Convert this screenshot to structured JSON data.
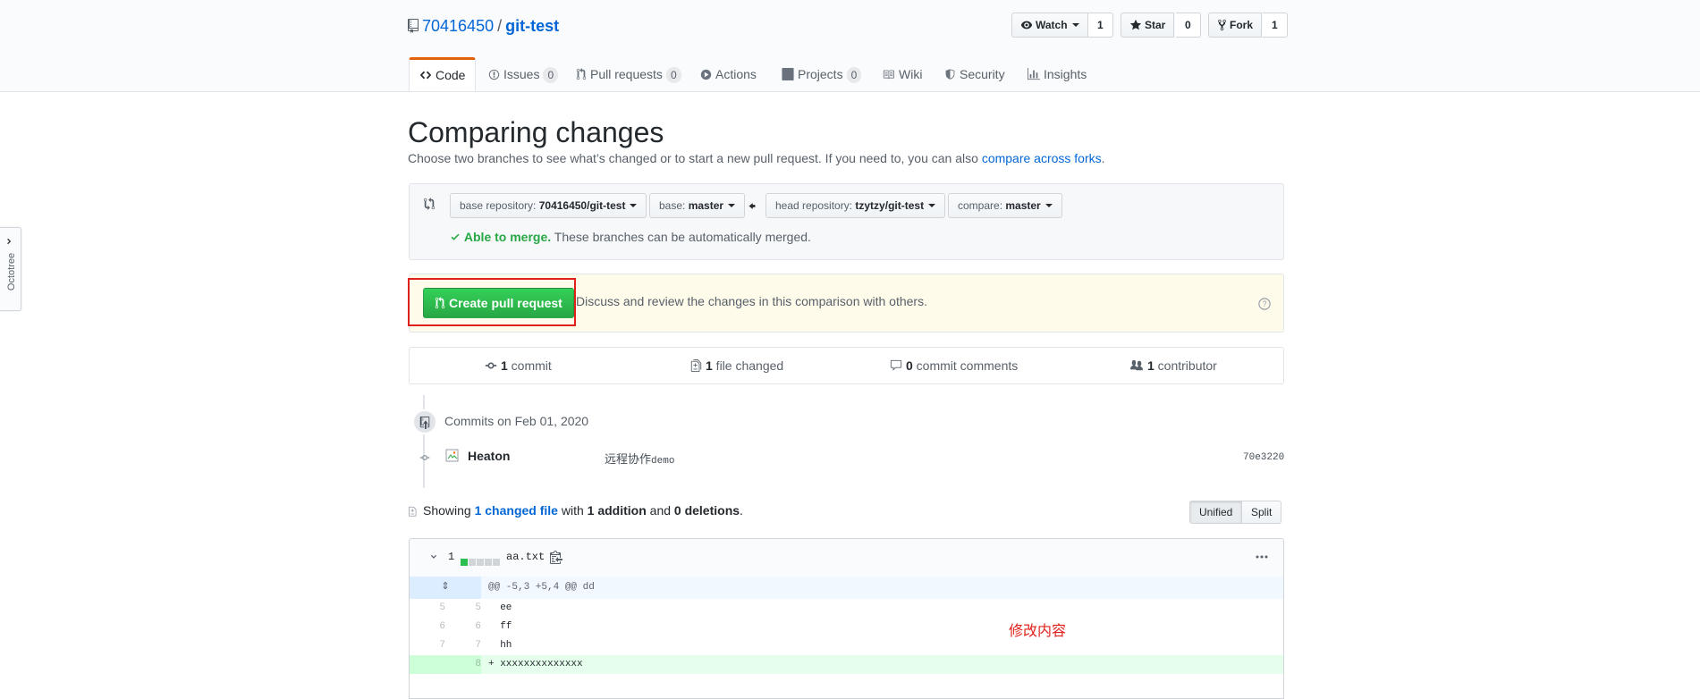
{
  "colors": {
    "accent": "#0366d6",
    "success": "#28a745",
    "selected_tab_border": "#e36209",
    "annotation_red": "#e0211b"
  },
  "repo": {
    "owner": "70416450",
    "separator": "/",
    "name": "git-test"
  },
  "actions": {
    "watch": {
      "label": "Watch",
      "count": "1"
    },
    "star": {
      "label": "Star",
      "count": "0"
    },
    "fork": {
      "label": "Fork",
      "count": "1"
    }
  },
  "tabs": [
    {
      "label": "Code",
      "icon": "code-icon"
    },
    {
      "label": "Issues",
      "count": "0",
      "icon": "issue-icon"
    },
    {
      "label": "Pull requests",
      "count": "0",
      "icon": "pull-request-icon"
    },
    {
      "label": "Actions",
      "icon": "play-icon"
    },
    {
      "label": "Projects",
      "count": "0",
      "icon": "project-icon"
    },
    {
      "label": "Wiki",
      "icon": "book-icon"
    },
    {
      "label": "Security",
      "icon": "shield-icon"
    },
    {
      "label": "Insights",
      "icon": "graph-icon"
    }
  ],
  "page": {
    "title": "Comparing changes",
    "subtitle": "Choose two branches to see what’s changed or to start a new pull request. If you need to, you can also ",
    "subtitle_link": "compare across forks",
    "subtitle_end": "."
  },
  "range": {
    "base_repo_label": "base repository: ",
    "base_repo_value": "70416450/git-test",
    "base_label": "base: ",
    "base_value": "master",
    "head_repo_label": "head repository: ",
    "head_repo_value": "tzytzy/git-test",
    "compare_label": "compare: ",
    "compare_value": "master",
    "merge_status": "Able to merge.",
    "merge_desc": " These branches can be automatically merged."
  },
  "pr": {
    "button_label": "Create pull request",
    "description": "Discuss and review the changes in this comparison with others."
  },
  "numbers": {
    "commits_count": "1",
    "commits_label": " commit",
    "files_count": "1",
    "files_label": " file changed",
    "comments_count": "0",
    "comments_label": " commit comments",
    "contributors_count": "1",
    "contributors_label": " contributor"
  },
  "commits": {
    "date_heading": "Commits on Feb 01, 2020",
    "items": [
      {
        "author": "Heaton",
        "message_cjk": "远程协作",
        "message_latin": "demo",
        "sha": "70e3220"
      }
    ]
  },
  "toc": {
    "prefix": "Showing ",
    "files_link": "1 changed file",
    "mid": " with ",
    "additions": "1 addition",
    "and": " and ",
    "deletions": "0 deletions",
    "end": ".",
    "unified": "Unified",
    "split": "Split"
  },
  "file": {
    "changes": "1",
    "name": "aa.txt",
    "hunk_header": "@@ -5,3 +5,4 @@ dd",
    "lines": [
      {
        "old": "5",
        "new": "5",
        "text": "  ee",
        "type": "context"
      },
      {
        "old": "6",
        "new": "6",
        "text": "  ff",
        "type": "context"
      },
      {
        "old": "7",
        "new": "7",
        "text": "  hh",
        "type": "context"
      },
      {
        "old": "",
        "new": "8",
        "text": "+ xxxxxxxxxxxxxx",
        "type": "addition"
      }
    ]
  },
  "annotation": "修改内容",
  "octotree": {
    "label": "Octotree"
  }
}
